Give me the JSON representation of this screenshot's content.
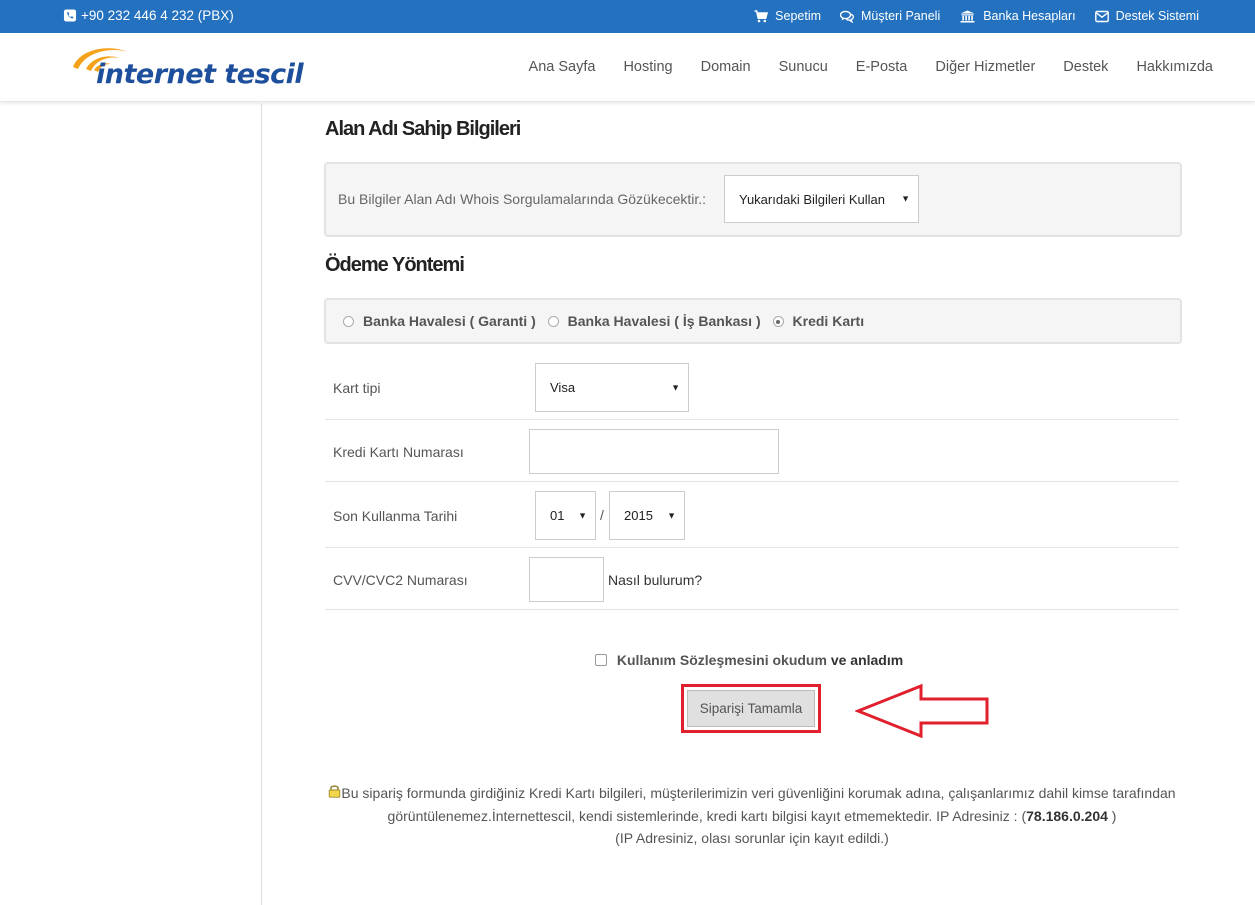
{
  "topbar": {
    "phone": "+90 232 446 4 232 (PBX)",
    "links": {
      "cart": "Sepetim",
      "client_panel": "Müşteri Paneli",
      "bank_accounts": "Banka Hesapları",
      "support": "Destek Sistemi"
    }
  },
  "header": {
    "logo_text": "internet tescil",
    "nav": [
      "Ana Sayfa",
      "Hosting",
      "Domain",
      "Sunucu",
      "E-Posta",
      "Diğer Hizmetler",
      "Destek",
      "Hakkımızda"
    ]
  },
  "owner_section": {
    "title": "Alan Adı Sahip Bilgileri",
    "whois_note": "Bu Bilgiler Alan Adı Whois Sorgulamalarında Gözükecektir.:",
    "whois_select": "Yukarıdaki Bilgileri Kullan"
  },
  "payment_section": {
    "title": "Ödeme Yöntemi",
    "methods": [
      {
        "label": "Banka Havalesi ( Garanti )",
        "selected": false
      },
      {
        "label": "Banka Havalesi ( İş Bankası )",
        "selected": false
      },
      {
        "label": "Kredi Kartı",
        "selected": true
      }
    ]
  },
  "card_form": {
    "card_type_label": "Kart tipi",
    "card_type_value": "Visa",
    "card_number_label": "Kredi Kartı Numarası",
    "card_number_value": "",
    "expiry_label": "Son Kullanma Tarihi",
    "expiry_month": "01",
    "expiry_separator": "/",
    "expiry_year": "2015",
    "cvv_label": "CVV/CVC2 Numarası",
    "cvv_value": "",
    "cvv_help": "Nasıl bulurum?"
  },
  "agreement": {
    "checked": false,
    "link_text": "Kullanım Sözleşmesini okudum",
    "suffix": "ve anladım"
  },
  "submit_button": "Siparişi Tamamla",
  "notice": {
    "text1": "Bu sipariş formunda girdiğiniz Kredi Kartı bilgileri, müşterilerimizin veri güvenliğini korumak adına, çalışanlarımız dahil kimse tarafından görüntülenemez.İnternettescil, kendi sistemlerinde, kredi kartı bilgisi kayıt etmemektedir. IP Adresiniz : (",
    "ip": "78.186.0.204",
    "text2": " )",
    "line2": "(IP Adresiniz, olası sorunlar için kayıt edildi.)"
  },
  "colors": {
    "topbar": "#2472bf",
    "logo_blue": "#1d4f9c",
    "logo_orange": "#f5a21b",
    "highlight_red": "#e0202c"
  }
}
